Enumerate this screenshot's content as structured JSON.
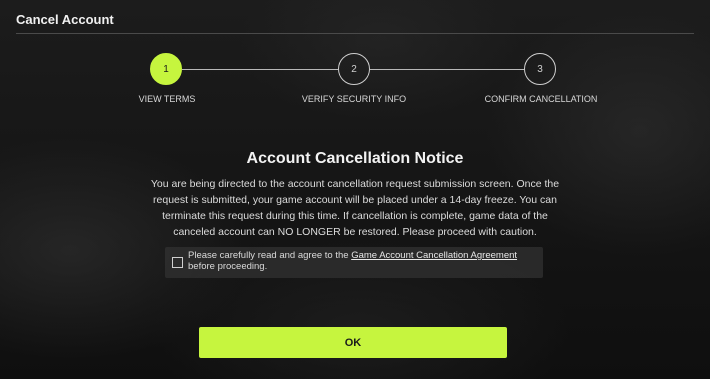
{
  "header": {
    "title": "Cancel Account"
  },
  "stepper": {
    "steps": [
      {
        "number": "1",
        "label": "VIEW TERMS",
        "active": true
      },
      {
        "number": "2",
        "label": "VERIFY SECURITY INFO",
        "active": false
      },
      {
        "number": "3",
        "label": "CONFIRM CANCELLATION",
        "active": false
      }
    ]
  },
  "notice": {
    "title": "Account Cancellation Notice",
    "body": "You are being directed to the account cancellation request submission screen. Once the request is submitted, your game account will be placed under a 14-day freeze. You can terminate this request during this time. If cancellation is complete, game data of the canceled account can NO LONGER be restored. Please proceed with caution."
  },
  "agreement": {
    "checked": false,
    "text_before": "Please carefully read and agree to the ",
    "link_text": "Game Account Cancellation Agreement",
    "text_after": " before proceeding."
  },
  "ok_button": {
    "label": "OK"
  },
  "colors": {
    "accent": "#c6f53e",
    "background": "#161616",
    "text": "#e6e6e6"
  }
}
